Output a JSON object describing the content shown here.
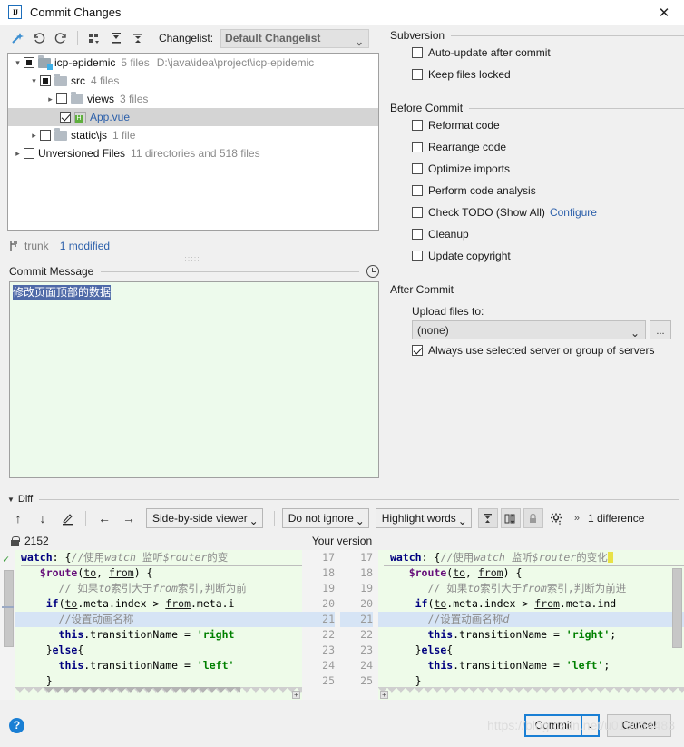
{
  "window": {
    "title": "Commit Changes",
    "app_icon": "IJ",
    "close_label": "✕"
  },
  "changelist_toolbar": {
    "icons": [
      "magic-wand-icon",
      "revert-icon",
      "refresh-icon",
      "group-by-icon",
      "expand-all-icon",
      "collapse-all-icon"
    ],
    "label": "Changelist:",
    "selected": "Default Changelist",
    "arrow": "⌄"
  },
  "tree": {
    "rows": [
      {
        "indent": 0,
        "chevron": "open",
        "check": "partial",
        "icon": "project-folder-icon",
        "name": "icp-epidemic",
        "meta": "5 files",
        "path": "D:\\java\\idea\\project\\icp-epidemic",
        "selected": false,
        "link": false
      },
      {
        "indent": 1,
        "chevron": "open",
        "check": "partial",
        "icon": "folder-icon",
        "name": "src",
        "meta": "4 files",
        "path": "",
        "selected": false,
        "link": false
      },
      {
        "indent": 2,
        "chevron": "closed",
        "check": "none",
        "icon": "folder-icon",
        "name": "views",
        "meta": "3 files",
        "path": "",
        "selected": false,
        "link": false
      },
      {
        "indent": 3,
        "chevron": "none",
        "check": "checked",
        "icon": "vue-file-icon",
        "name": "App.vue",
        "meta": "",
        "path": "",
        "selected": true,
        "link": true
      },
      {
        "indent": 1,
        "chevron": "closed",
        "check": "none",
        "icon": "folder-icon",
        "name": "static\\js",
        "meta": "1 file",
        "path": "",
        "selected": false,
        "link": false
      },
      {
        "indent": 0,
        "chevron": "closed",
        "check": "none",
        "icon": "none",
        "name": "Unversioned Files",
        "meta": "11 directories and 518 files",
        "path": "",
        "selected": false,
        "link": false
      }
    ]
  },
  "branch": {
    "icon": "branch-icon",
    "name": "trunk",
    "modified": "1 modified"
  },
  "commit_message": {
    "title": "Commit Message",
    "history_icon": "clock-icon",
    "text": "修改页面顶部的数据"
  },
  "subversion": {
    "title": "Subversion",
    "options": [
      {
        "label": "Auto-update after commit",
        "checked": false,
        "underline": ""
      },
      {
        "label": "Keep files locked",
        "checked": false,
        "underline": "K"
      }
    ]
  },
  "before_commit": {
    "title": "Before Commit",
    "options": [
      {
        "label": "Reformat code",
        "checked": false,
        "underline": "R"
      },
      {
        "label": "Rearrange code",
        "checked": false,
        "underline": "n"
      },
      {
        "label": "Optimize imports",
        "checked": false,
        "underline": "O"
      },
      {
        "label": "Perform code analysis",
        "checked": false,
        "underline": "s"
      },
      {
        "label": "Check TODO (Show All)",
        "checked": false,
        "underline": "",
        "link": "Configure"
      },
      {
        "label": "Cleanup",
        "checked": false,
        "underline": "l"
      },
      {
        "label": "Update copyright",
        "checked": false,
        "underline": ""
      }
    ]
  },
  "after_commit": {
    "title": "After Commit",
    "upload_label": "Upload files to:",
    "upload_value": "(none)",
    "upload_arrow": "⌄",
    "browse_label": "...",
    "always_use": {
      "label": "Always use selected server or group of servers",
      "checked": true
    }
  },
  "diff": {
    "title": "Diff",
    "caret": "▼",
    "toolbar": {
      "prev_diff_icon": "arrow-up-icon",
      "next_diff_icon": "arrow-down-icon",
      "edit_icon": "pencil-icon",
      "apply_left_icon": "arrow-left-icon",
      "apply_right_icon": "arrow-right-icon",
      "viewer_mode": "Side-by-side viewer",
      "ignore_mode": "Do not ignore",
      "highlight_mode": "Highlight words",
      "collapse_icon": "collapse-unchanged-icon",
      "sync_scroll_icon": "sync-scroll-icon",
      "lock_icon": "lock-icon",
      "settings_icon": "gear-icon",
      "overflow_icon": "»",
      "difference_count": "1 difference",
      "arrow": "⌄"
    },
    "left_header": {
      "lock_icon": "lock-icon",
      "revision": "2152"
    },
    "right_header": "Your version",
    "left_lines": [
      {
        "num": "",
        "hl": false
      },
      {
        "num": "",
        "hl": false
      },
      {
        "num": "",
        "hl": false
      },
      {
        "num": "",
        "hl": false
      },
      {
        "num": "",
        "hl": true
      },
      {
        "num": "",
        "hl": false
      },
      {
        "num": "",
        "hl": false
      },
      {
        "num": "",
        "hl": false
      },
      {
        "num": "",
        "hl": false
      }
    ],
    "line_numbers": [
      "17",
      "18",
      "19",
      "20",
      "21",
      "22",
      "23",
      "24",
      "25"
    ],
    "code_left": [
      "watch: {//使用watch 监听$router的变",
      "  $route(to, from) {",
      "      // 如果to索引大于from索引,判断为前",
      "    if(to.meta.index > from.meta.i",
      "      //设置动画名称",
      "      this.transitionName = 'right",
      "    }else{",
      "      this.transitionName = 'left'",
      "    }"
    ],
    "code_right": [
      "watch: {//使用watch 监听$router的变化",
      "  $route(to, from) {",
      "      // 如果to索引大于from索引,判断为前进",
      "    if(to.meta.index > from.meta.ind",
      "      //设置动画名称d",
      "      this.transitionName = 'right';",
      "    }else{",
      "      this.transitionName = 'left';",
      "    }"
    ]
  },
  "footer": {
    "help_icon": "?",
    "commit_label": "Commit",
    "commit_arrow": "⌄",
    "cancel_label": "Cancel",
    "watermark": "https://blog.csdn.net/u013054483"
  }
}
